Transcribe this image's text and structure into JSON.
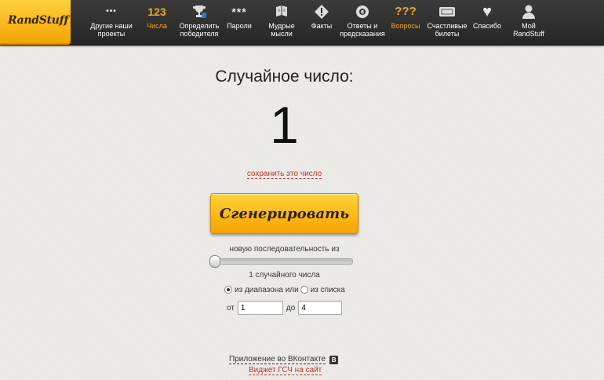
{
  "brand": {
    "logo_text": "RandStuff"
  },
  "nav": {
    "items": [
      {
        "id": "projects",
        "icon": "dots-icon",
        "glyph": "•••",
        "line1": "Другие наши",
        "line2": "проекты"
      },
      {
        "id": "numbers",
        "icon": "numbers-icon",
        "glyph": "123",
        "line1": "Числа",
        "line2": ""
      },
      {
        "id": "winner",
        "icon": "trophy-icon",
        "glyph": "🏆",
        "line1": "Определить",
        "line2": "победителя"
      },
      {
        "id": "passwords",
        "icon": "asterisks-icon",
        "glyph": "***",
        "line1": "Пароли",
        "line2": ""
      },
      {
        "id": "wisdom",
        "icon": "book-icon",
        "glyph": "▤",
        "line1": "Мудрые",
        "line2": "мысли"
      },
      {
        "id": "facts",
        "icon": "warning-icon",
        "glyph": "⚠",
        "line1": "Факты",
        "line2": ""
      },
      {
        "id": "answers",
        "icon": "eight-ball-icon",
        "glyph": "●",
        "line1": "Ответы и",
        "line2": "предсказания"
      },
      {
        "id": "questions",
        "icon": "question-marks-icon",
        "glyph": "???",
        "line1": "Вопросы",
        "line2": ""
      },
      {
        "id": "tickets",
        "icon": "ticket-icon",
        "glyph": "▭",
        "line1": "Счастливые",
        "line2": "билеты"
      },
      {
        "id": "thanks",
        "icon": "heart-icon",
        "glyph": "♥",
        "line1": "Спасибо",
        "line2": ""
      },
      {
        "id": "my",
        "icon": "user-icon",
        "glyph": "👤",
        "line1": "Мой",
        "line2": "RandStuff"
      }
    ]
  },
  "main": {
    "title": "Случайное число:",
    "number": "1",
    "save_link": "сохранить это число",
    "generate_label": "Сгенерировать",
    "sequence_label": "новую последовательность из",
    "slider_value": 1,
    "count_label": "1 случайного числа",
    "mode": {
      "range_label": "из диапазона или",
      "list_label": "из списка",
      "selected": "range"
    },
    "range": {
      "from_label": "от",
      "from_value": "1",
      "to_label": "до",
      "to_value": "4"
    }
  },
  "footer": {
    "vk_app_label": "Приложение во ВКонтакте",
    "vk_glyph": "B",
    "widget_label": "Виджет ГСЧ на сайт"
  },
  "colors": {
    "accent": "#f5a818",
    "link": "#b53a2b",
    "topbar": "#2f2f2f"
  }
}
